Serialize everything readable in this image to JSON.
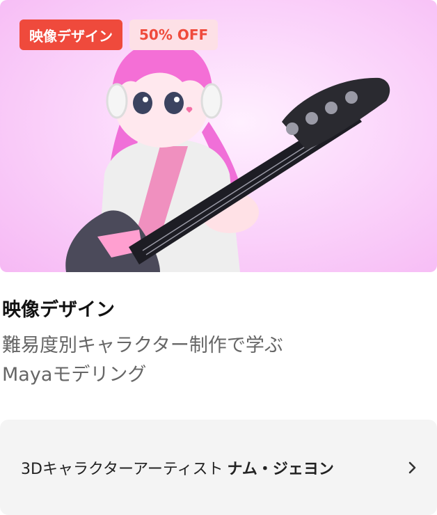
{
  "thumbnail": {
    "category_badge": "映像デザイン",
    "discount_badge": "50% OFF"
  },
  "category": "映像デザイン",
  "course_title": {
    "line1": "難易度別キャラクター制作で学ぶ",
    "line2": "Mayaモデリング"
  },
  "instructor": {
    "role": "3Dキャラクターアーティスト",
    "name": "ナム・ジェヨン"
  },
  "colors": {
    "accent": "#ef4a3c",
    "discount_bg": "#fde0e6",
    "panel_bg": "#f4f4f4"
  },
  "icons": {
    "chevron": "chevron-right-icon"
  }
}
